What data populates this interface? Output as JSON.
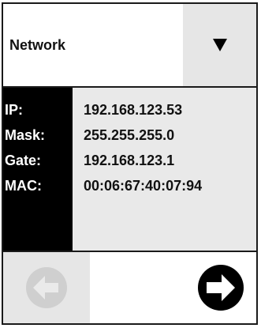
{
  "dropdown": {
    "selected": "Network",
    "arrow_icon": "triangle-down-icon"
  },
  "network_info": {
    "rows": [
      {
        "label": "IP:",
        "value": "192.168.123.53"
      },
      {
        "label": "Mask:",
        "value": "255.255.255.0"
      },
      {
        "label": "Gate:",
        "value": "192.168.123.1"
      },
      {
        "label": "MAC:",
        "value": "00:06:67:40:07:94"
      }
    ]
  },
  "navigation": {
    "back_icon": "arrow-left-circle-icon",
    "back_enabled": false,
    "next_icon": "arrow-right-circle-icon",
    "next_enabled": true
  },
  "colors": {
    "label_bg": "#000000",
    "value_bg": "#e9e9e9",
    "button_bg": "#e6e6e6",
    "disabled_icon": "#cfcfcf"
  }
}
